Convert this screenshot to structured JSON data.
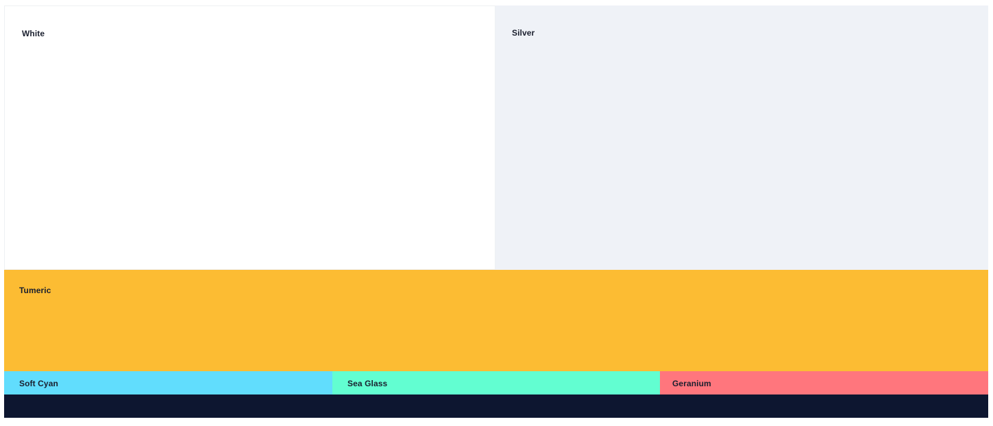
{
  "swatches": [
    {
      "id": "white",
      "label": "White",
      "color": "#ffffff"
    },
    {
      "id": "silver",
      "label": "Silver",
      "color": "#eff2f7"
    },
    {
      "id": "tumeric",
      "label": "Tumeric",
      "color": "#fcbc33"
    },
    {
      "id": "soft-cyan",
      "label": "Soft Cyan",
      "color": "#61ddfd"
    },
    {
      "id": "sea-glass",
      "label": "Sea Glass",
      "color": "#62fed1"
    },
    {
      "id": "geranium",
      "label": "Geranium",
      "color": "#ff767d"
    },
    {
      "id": "navy",
      "label": "",
      "color": "#0d1630"
    }
  ]
}
